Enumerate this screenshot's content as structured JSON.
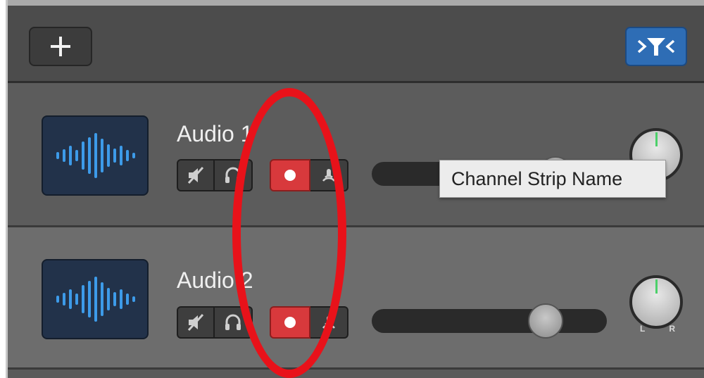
{
  "toolbar": {
    "add_button_icon": "plus-icon",
    "smart_controls_icon": "smart-controls-icon",
    "smart_controls_color": "#2e6db5"
  },
  "tracks": [
    {
      "name": "Audio 1",
      "icon": "waveform-icon",
      "mute_icon": "mute-icon",
      "solo_icon": "headphones-icon",
      "record_enabled": true,
      "record_color": "#d8393c",
      "monitor_icon": "input-monitor-icon",
      "volume": 0.78,
      "pan": 0.0
    },
    {
      "name": "Audio 2",
      "icon": "waveform-icon",
      "mute_icon": "mute-icon",
      "solo_icon": "headphones-icon",
      "record_enabled": true,
      "record_color": "#d8393c",
      "monitor_icon": "input-monitor-icon",
      "volume": 0.72,
      "pan": 0.0,
      "pan_left_label": "L",
      "pan_right_label": "R"
    }
  ],
  "tooltip": {
    "text": "Channel Strip Name"
  },
  "annotation": {
    "type": "circle-highlight",
    "color": "#e8121a"
  }
}
